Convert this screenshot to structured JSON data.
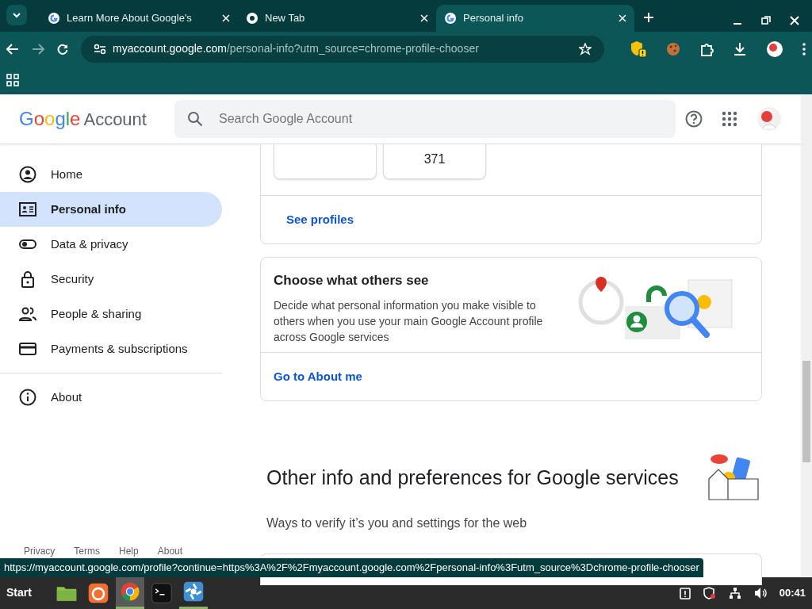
{
  "browser": {
    "tabs": [
      {
        "title": "Learn More About Google's",
        "kind": "google",
        "selected": false
      },
      {
        "title": "New Tab",
        "kind": "chrome",
        "selected": false
      },
      {
        "title": "Personal info",
        "kind": "google",
        "selected": true
      }
    ],
    "address": {
      "host": "myaccount.google.com",
      "path": "/personal-info?utm_source=chrome-profile-chooser"
    }
  },
  "header": {
    "logo_brand": "Google",
    "logo_product": "Account",
    "search": {
      "placeholder": "Search Google Account"
    }
  },
  "sidebar": {
    "items": [
      {
        "label": "Home",
        "kind": "home",
        "selected": false
      },
      {
        "label": "Personal info",
        "kind": "id",
        "selected": true
      },
      {
        "label": "Data & privacy",
        "kind": "toggle",
        "selected": false
      },
      {
        "label": "Security",
        "kind": "lock",
        "selected": false
      },
      {
        "label": "People & sharing",
        "kind": "people",
        "selected": false
      },
      {
        "label": "Payments & subscriptions",
        "kind": "card",
        "selected": false
      },
      {
        "label": "About",
        "kind": "info",
        "selected": false
      }
    ],
    "footer_links": [
      "Privacy",
      "Terms",
      "Help",
      "About"
    ]
  },
  "profiles_card": {
    "tile_count": "371",
    "link": "See profiles"
  },
  "others_card": {
    "title": "Choose what others see",
    "description": "Decide what personal information you make visible to others when you use your main Google Account profile across Google services",
    "link": "Go to About me"
  },
  "section": {
    "title": "Other info and preferences for Google services",
    "subtitle": "Ways to verify it’s you and settings for the web"
  },
  "status_url": "https://myaccount.google.com/profile?continue=https%3A%2F%2Fmyaccount.google.com%2Fpersonal-info%3Futm_source%3Dchrome-profile-chooser",
  "taskbar": {
    "start": "Start",
    "apps": [
      {
        "kind": "files",
        "selected": false,
        "running": false
      },
      {
        "kind": "firefox",
        "selected": false,
        "running": false
      },
      {
        "kind": "chrome",
        "selected": true,
        "running": true
      },
      {
        "kind": "terminal",
        "selected": false,
        "running": false
      },
      {
        "kind": "swirl",
        "selected": false,
        "running": true
      }
    ],
    "clock": "00:41"
  }
}
